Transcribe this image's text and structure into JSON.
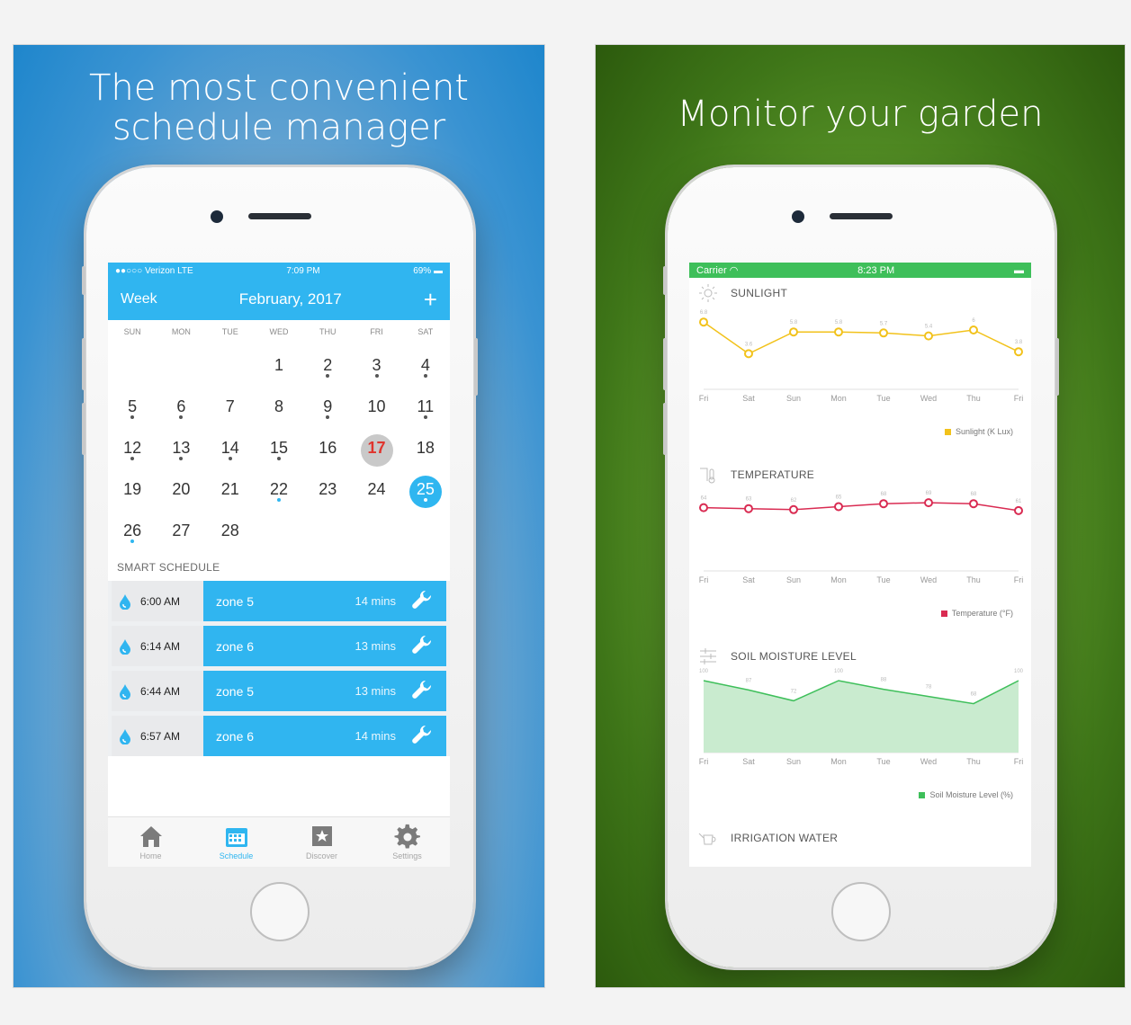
{
  "left_panel": {
    "headline": [
      "The most convenient",
      "schedule manager"
    ],
    "status": {
      "carrier": "●●○○○ Verizon  LTE",
      "time": "7:09 PM",
      "battery": "69%"
    },
    "header": {
      "view_label": "Week",
      "month_label": "February, 2017",
      "add_label": "+"
    },
    "weekdays": [
      "SUN",
      "MON",
      "TUE",
      "WED",
      "THU",
      "FRI",
      "SAT"
    ],
    "days": [
      {
        "n": ""
      },
      {
        "n": ""
      },
      {
        "n": ""
      },
      {
        "n": "1"
      },
      {
        "n": "2",
        "dot": true
      },
      {
        "n": "3",
        "dot": true
      },
      {
        "n": "4",
        "dot": true
      },
      {
        "n": "5",
        "dot": true
      },
      {
        "n": "6",
        "dot": true
      },
      {
        "n": "7"
      },
      {
        "n": "8"
      },
      {
        "n": "9",
        "dot": true
      },
      {
        "n": "10"
      },
      {
        "n": "11",
        "dot": true
      },
      {
        "n": "12",
        "dot": true
      },
      {
        "n": "13",
        "dot": true
      },
      {
        "n": "14",
        "dot": true
      },
      {
        "n": "15",
        "dot": true
      },
      {
        "n": "16"
      },
      {
        "n": "17",
        "state": "today"
      },
      {
        "n": "18"
      },
      {
        "n": "19"
      },
      {
        "n": "20"
      },
      {
        "n": "21"
      },
      {
        "n": "22",
        "dot": "blue"
      },
      {
        "n": "23"
      },
      {
        "n": "24"
      },
      {
        "n": "25",
        "state": "selected",
        "dot": "blue"
      },
      {
        "n": "26",
        "dot": "blue"
      },
      {
        "n": "27"
      },
      {
        "n": "28"
      },
      {
        "n": ""
      },
      {
        "n": ""
      },
      {
        "n": ""
      },
      {
        "n": ""
      }
    ],
    "section_title": "SMART SCHEDULE",
    "schedule": [
      {
        "time": "6:00 AM",
        "zone": "zone 5",
        "duration": "14 mins"
      },
      {
        "time": "6:14 AM",
        "zone": "zone 6",
        "duration": "13 mins"
      },
      {
        "time": "6:44 AM",
        "zone": "zone 5",
        "duration": "13 mins"
      },
      {
        "time": "6:57 AM",
        "zone": "zone 6",
        "duration": "14 mins"
      }
    ],
    "tabs": [
      {
        "label": "Home",
        "icon": "home-icon"
      },
      {
        "label": "Schedule",
        "icon": "calendar-icon",
        "active": true
      },
      {
        "label": "Discover",
        "icon": "star-icon"
      },
      {
        "label": "Settings",
        "icon": "gear-icon"
      }
    ],
    "colors": {
      "accent": "#30b5f0",
      "today": "#e0342d"
    }
  },
  "right_panel": {
    "headline": [
      "Monitor your garden"
    ],
    "status": {
      "carrier": "Carrier",
      "time": "8:23 PM"
    },
    "colors": {
      "sunlight": "#f2c21b",
      "temperature": "#d92b52",
      "moisture": "#3ebf5a",
      "status_bar": "#3ebf5a"
    },
    "metrics": [
      {
        "title": "SUNLIGHT",
        "icon": "sun-icon",
        "legend": "Sunlight (K Lux)"
      },
      {
        "title": "TEMPERATURE",
        "icon": "thermometer-icon",
        "legend": "Temperature (°F)"
      },
      {
        "title": "SOIL MOISTURE LEVEL",
        "icon": "sliders-icon",
        "legend": "Soil Moisture Level (%)"
      },
      {
        "title": "IRRIGATION WATER",
        "icon": "watering-can-icon",
        "legend": ""
      }
    ]
  },
  "chart_data": [
    {
      "type": "line",
      "title": "SUNLIGHT",
      "categories": [
        "Fri",
        "Sat",
        "Sun",
        "Mon",
        "Tue",
        "Wed",
        "Thu",
        "Fri"
      ],
      "series": [
        {
          "name": "Sunlight (K Lux)",
          "values": [
            6.8,
            3.6,
            5.8,
            5.8,
            5.7,
            5.4,
            6.0,
            3.8
          ]
        }
      ],
      "ylim": [
        0,
        8
      ]
    },
    {
      "type": "line",
      "title": "TEMPERATURE",
      "categories": [
        "Fri",
        "Sat",
        "Sun",
        "Mon",
        "Tue",
        "Wed",
        "Thu",
        "Fri"
      ],
      "series": [
        {
          "name": "Temperature (°F)",
          "values": [
            64,
            63,
            62,
            65,
            68,
            69,
            68,
            61
          ]
        }
      ],
      "ylim": [
        0,
        80
      ]
    },
    {
      "type": "area",
      "title": "SOIL MOISTURE LEVEL",
      "categories": [
        "Fri",
        "Sat",
        "Sun",
        "Mon",
        "Tue",
        "Wed",
        "Thu",
        "Fri"
      ],
      "series": [
        {
          "name": "Soil Moisture Level (%)",
          "values": [
            100,
            87,
            72,
            100,
            88,
            78,
            68,
            100
          ]
        }
      ],
      "ylim": [
        0,
        110
      ]
    }
  ]
}
